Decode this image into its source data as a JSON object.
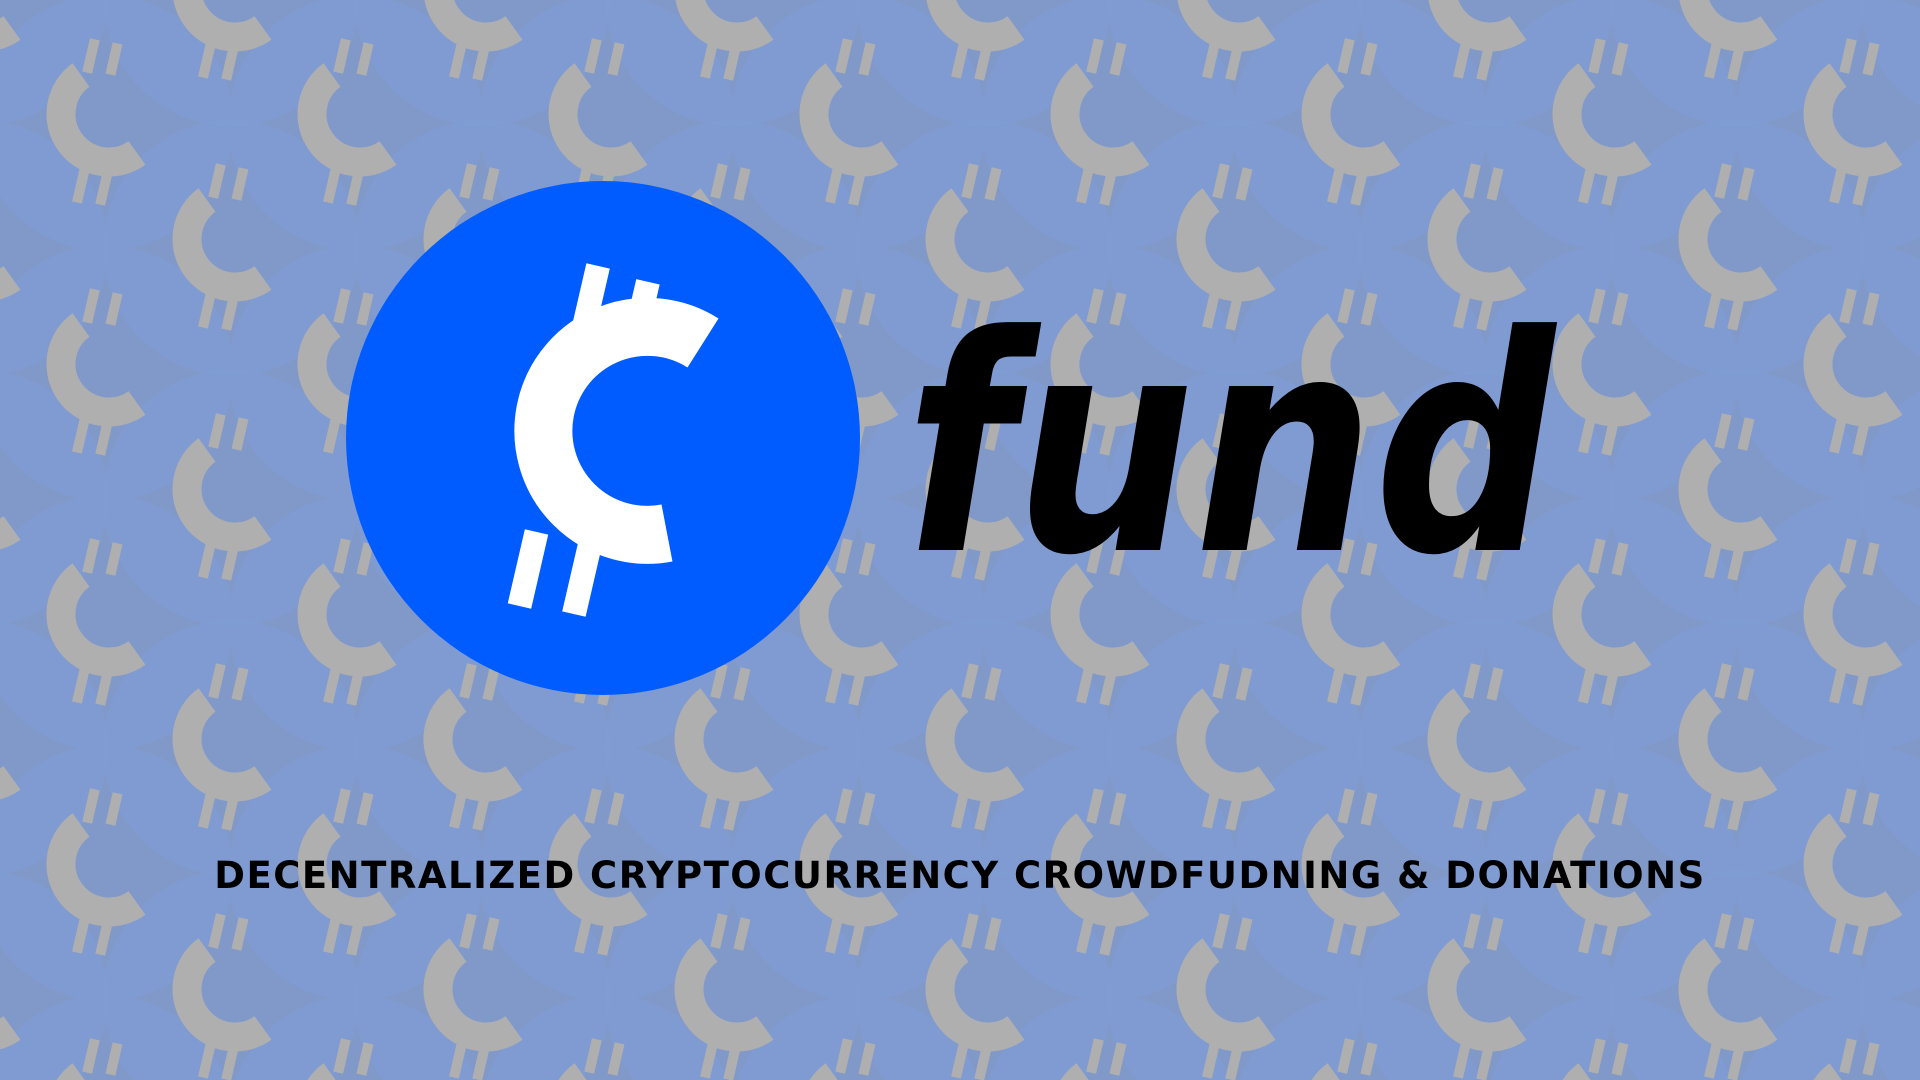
{
  "brand": {
    "wordmark": "fund",
    "tagline": "DECENTRALIZED CRYPTOCURRENCY CROWDFUDNING & DONATIONS",
    "logo_icon": "cent-coin-icon"
  },
  "background": {
    "pattern_icon": "cent-coin-icon"
  },
  "colors": {
    "page_background": "#8e8e93",
    "pattern_circle": "#7f9bd2",
    "pattern_glyph": "#afafaf",
    "logo_circle": "#005cff",
    "logo_glyph": "#ffffff",
    "text": "#000000"
  }
}
